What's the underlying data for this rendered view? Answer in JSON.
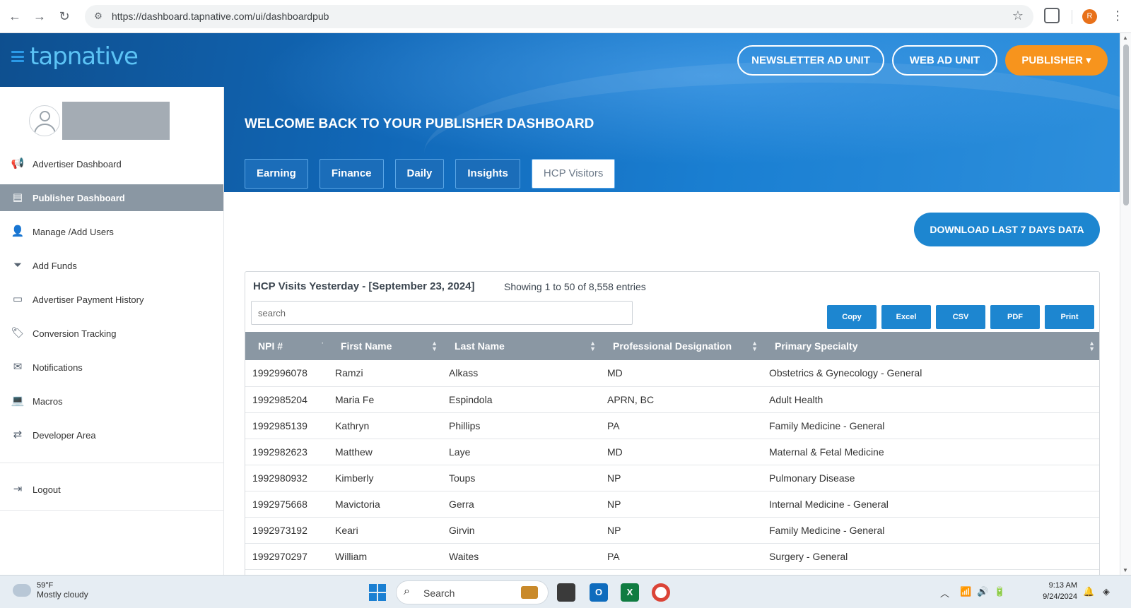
{
  "browser": {
    "url": "https://dashboard.tapnative.com/ui/dashboardpub",
    "profile_initial": "R"
  },
  "header": {
    "brand": "tapnative",
    "buttons": {
      "newsletter": "NEWSLETTER AD UNIT",
      "web": "WEB AD UNIT",
      "publisher": "PUBLISHER ▾"
    },
    "welcome": "WELCOME BACK TO YOUR PUBLISHER DASHBOARD",
    "tabs": [
      "Earning",
      "Finance",
      "Daily",
      "Insights",
      "HCP Visitors"
    ],
    "active_tab": "HCP Visitors"
  },
  "sidebar": {
    "items": [
      {
        "label": "Advertiser Dashboard",
        "icon": "megaphone-icon"
      },
      {
        "label": "Publisher Dashboard",
        "icon": "book-icon"
      },
      {
        "label": "Manage /Add Users",
        "icon": "user-icon"
      },
      {
        "label": "Add Funds",
        "icon": "funnel-dollar-icon"
      },
      {
        "label": "Advertiser Payment History",
        "icon": "money-card-icon"
      },
      {
        "label": "Conversion Tracking",
        "icon": "tag-icon"
      },
      {
        "label": "Notifications",
        "icon": "envelope-icon"
      },
      {
        "label": "Macros",
        "icon": "laptop-code-icon"
      },
      {
        "label": "Developer Area",
        "icon": "shuffle-icon"
      }
    ],
    "active_item": "Publisher Dashboard",
    "logout": {
      "label": "Logout",
      "icon": "sign-out-icon"
    }
  },
  "content": {
    "download_button": "DOWNLOAD LAST 7 DAYS DATA",
    "panel_title": "HCP Visits Yesterday - [September 23, 2024]",
    "showing": "Showing 1 to 50 of 8,558 entries",
    "search_placeholder": "search",
    "export_buttons": [
      "Copy",
      "Excel",
      "CSV",
      "PDF",
      "Print"
    ],
    "table": {
      "columns": [
        "NPI #",
        "First Name",
        "Last Name",
        "Professional Designation",
        "Primary Specialty"
      ],
      "rows": [
        [
          "1992996078",
          "Ramzi",
          "Alkass",
          "MD",
          "Obstetrics & Gynecology - General"
        ],
        [
          "1992985204",
          "Maria Fe",
          "Espindola",
          "APRN, BC",
          "Adult Health"
        ],
        [
          "1992985139",
          "Kathryn",
          "Phillips",
          "PA",
          "Family Medicine - General"
        ],
        [
          "1992982623",
          "Matthew",
          "Laye",
          "MD",
          "Maternal & Fetal Medicine"
        ],
        [
          "1992980932",
          "Kimberly",
          "Toups",
          "NP",
          "Pulmonary Disease"
        ],
        [
          "1992975668",
          "Mavictoria",
          "Gerra",
          "NP",
          "Internal Medicine - General"
        ],
        [
          "1992973192",
          "Keari",
          "Girvin",
          "NP",
          "Family Medicine - General"
        ],
        [
          "1992970297",
          "William",
          "Waites",
          "PA",
          "Surgery - General"
        ]
      ]
    }
  },
  "taskbar": {
    "weather_temp": "59°F",
    "weather_desc": "Mostly cloudy",
    "search_label": "Search",
    "time": "9:13 AM",
    "date": "9/24/2024"
  },
  "colors": {
    "accent_blue": "#1d86d0",
    "publisher_orange": "#f7941d",
    "table_header": "#8a97a3"
  }
}
